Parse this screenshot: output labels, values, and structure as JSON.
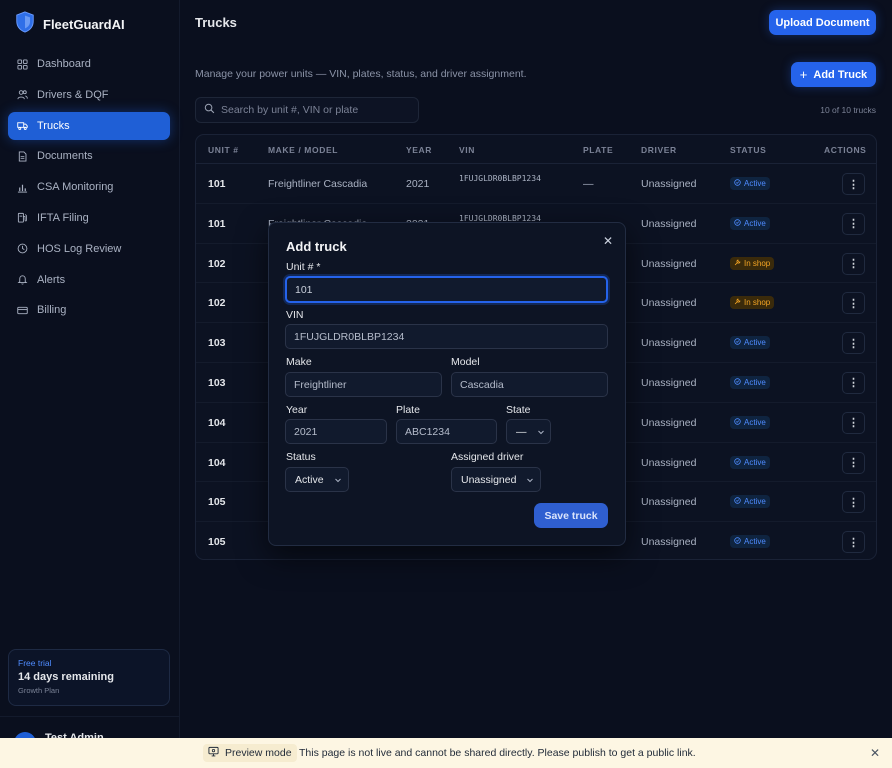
{
  "app": {
    "name": "FleetGuardAI"
  },
  "sidebar": {
    "items": [
      {
        "label": "Dashboard",
        "icon": "dashboard-icon"
      },
      {
        "label": "Drivers & DQF",
        "icon": "users-icon"
      },
      {
        "label": "Trucks",
        "icon": "truck-icon",
        "active": true
      },
      {
        "label": "Documents",
        "icon": "document-icon"
      },
      {
        "label": "CSA Monitoring",
        "icon": "bar-chart-icon"
      },
      {
        "label": "IFTA Filing",
        "icon": "fuel-icon"
      },
      {
        "label": "HOS Log Review",
        "icon": "clock-icon"
      },
      {
        "label": "Alerts",
        "icon": "bell-icon"
      },
      {
        "label": "Billing",
        "icon": "credit-card-icon"
      }
    ],
    "trial": {
      "badge": "Free trial",
      "remaining": "14 days remaining",
      "plan": "Growth Plan"
    },
    "user": {
      "name": "Test Admin"
    }
  },
  "header": {
    "title": "Trucks",
    "upload_label": "Upload Document",
    "add_truck_label": "Add Truck",
    "subtitle": "Manage your power units — VIN, plates, status, and driver assignment.",
    "search_placeholder": "Search by unit #, VIN or plate",
    "count_text": "10 of 10 trucks"
  },
  "table": {
    "columns": [
      "UNIT #",
      "MAKE / MODEL",
      "YEAR",
      "VIN",
      "PLATE",
      "DRIVER",
      "STATUS",
      "ACTIONS"
    ],
    "rows": [
      {
        "unit": "101",
        "make_model": "Freightliner Cascadia",
        "year": "2021",
        "vin": "1FUJGLDR0BLBP1234",
        "plate": "—",
        "driver": "Unassigned",
        "status": "Active"
      },
      {
        "unit": "101",
        "make_model": "Freightliner Cascadia",
        "year": "2021",
        "vin": "1FUJGLDR0BLBP1234",
        "plate": "—",
        "driver": "Unassigned",
        "status": "Active"
      },
      {
        "unit": "102",
        "make_model": "",
        "year": "",
        "vin": "",
        "plate": "",
        "driver": "Unassigned",
        "status": "In shop"
      },
      {
        "unit": "102",
        "make_model": "",
        "year": "",
        "vin": "",
        "plate": "",
        "driver": "Unassigned",
        "status": "In shop"
      },
      {
        "unit": "103",
        "make_model": "",
        "year": "",
        "vin": "",
        "plate": "",
        "driver": "Unassigned",
        "status": "Active"
      },
      {
        "unit": "103",
        "make_model": "",
        "year": "",
        "vin": "",
        "plate": "",
        "driver": "Unassigned",
        "status": "Active"
      },
      {
        "unit": "104",
        "make_model": "",
        "year": "",
        "vin": "",
        "plate": "",
        "driver": "Unassigned",
        "status": "Active"
      },
      {
        "unit": "104",
        "make_model": "",
        "year": "",
        "vin": "",
        "plate": "",
        "driver": "Unassigned",
        "status": "Active"
      },
      {
        "unit": "105",
        "make_model": "",
        "year": "",
        "vin": "",
        "plate": "",
        "driver": "Unassigned",
        "status": "Active"
      },
      {
        "unit": "105",
        "make_model": "",
        "year": "",
        "vin": "",
        "plate": "",
        "driver": "Unassigned",
        "status": "Active"
      }
    ],
    "action_glyph": "⋮"
  },
  "modal": {
    "title": "Add truck",
    "unit_label": "Unit # *",
    "unit_value": "101",
    "vin_label": "VIN",
    "vin_value": "1FUJGLDR0BLBP1234",
    "make_label": "Make",
    "make_value": "Freightliner",
    "model_label": "Model",
    "model_value": "Cascadia",
    "year_label": "Year",
    "year_value": "2021",
    "plate_label": "Plate",
    "plate_value": "ABC1234",
    "state_label": "State",
    "state_value": "—",
    "status_label": "Status",
    "status_value": "Active",
    "driver_label": "Assigned driver",
    "driver_value": "Unassigned",
    "save_label": "Save truck"
  },
  "banner": {
    "mode_label": "Preview mode",
    "message": "This page is not live and cannot be shared directly. Please publish to get a public link."
  },
  "colors": {
    "accent": "#2563eb",
    "active_badge": "#4f8cff",
    "shop_badge": "#f5a524",
    "background": "#0a0f1e"
  }
}
